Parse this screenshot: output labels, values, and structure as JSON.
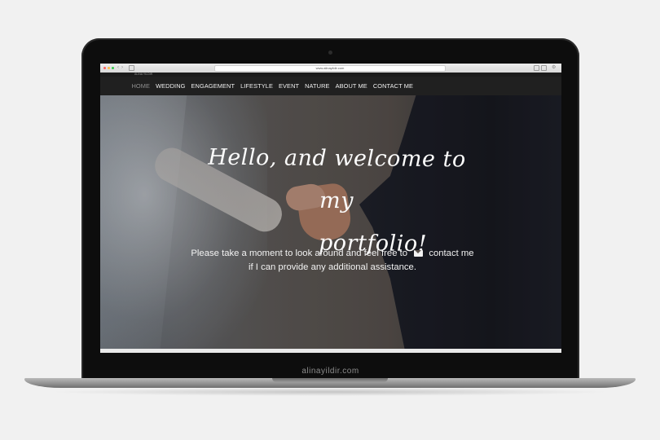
{
  "browser": {
    "tab_title": "ALINA YILDIR",
    "url": "www.alinayildir.com"
  },
  "nav": {
    "items": [
      "HOME",
      "WEDDING",
      "ENGAGEMENT",
      "LIFESTYLE",
      "EVENT",
      "NATURE",
      "ABOUT ME",
      "CONTACT ME"
    ],
    "active": "HOME"
  },
  "hero": {
    "headline_line1": "Hello, and welcome to my",
    "headline_line2": "portfolio!",
    "subtext_part1": "Please take a moment to look around and feel free to",
    "contact_icon": "envelope-icon",
    "subtext_part2": "contact me  if I can provide any additional assistance."
  },
  "laptop": {
    "brand_text": "alinayildir.com"
  },
  "colors": {
    "nav_bg": "#202020",
    "nav_text": "#f0f0f0",
    "nav_active": "#8f8f8f",
    "page_bg": "#f1f1f1"
  }
}
